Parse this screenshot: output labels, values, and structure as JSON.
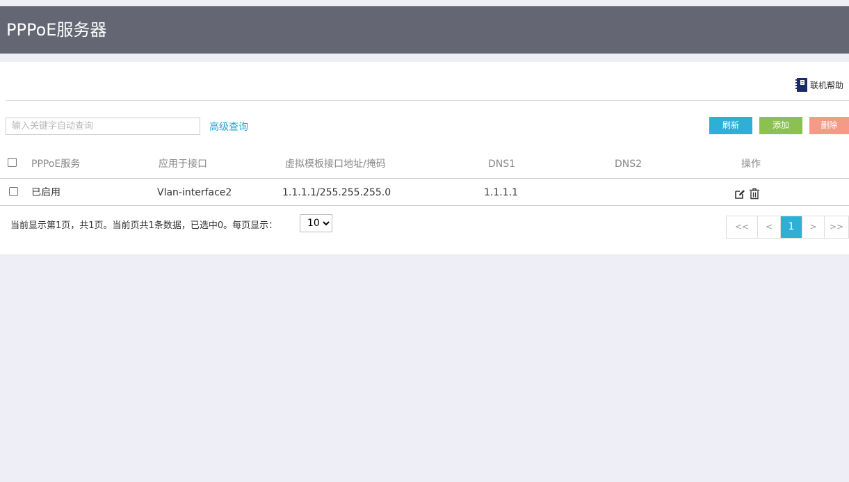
{
  "header": {
    "title": "PPPoE服务器"
  },
  "toolbar": {
    "help_label": "联机帮助",
    "search_placeholder": "输入关键字自动查询",
    "advanced_label": "高级查询",
    "refresh_label": "刷新",
    "add_label": "添加",
    "delete_label": "删除"
  },
  "table": {
    "columns": [
      "PPPoE服务",
      "应用于接口",
      "虚拟模板接口地址/掩码",
      "DNS1",
      "DNS2",
      "操作"
    ],
    "rows": [
      {
        "service": "已启用",
        "interface": "Vlan-interface2",
        "address": "1.1.1.1/255.255.255.0",
        "dns1": "1.1.1.1",
        "dns2": ""
      }
    ]
  },
  "pagination": {
    "info": "当前显示第1页，共1页。当前页共1条数据，已选中0。每页显示：",
    "page_size": "10",
    "first": "<<",
    "prev": "<",
    "current": "1",
    "next": ">",
    "last": ">>"
  },
  "colors": {
    "header_bg": "#646673",
    "accent": "#2eb0d6",
    "add": "#8cc152",
    "delete": "#f39b87"
  }
}
